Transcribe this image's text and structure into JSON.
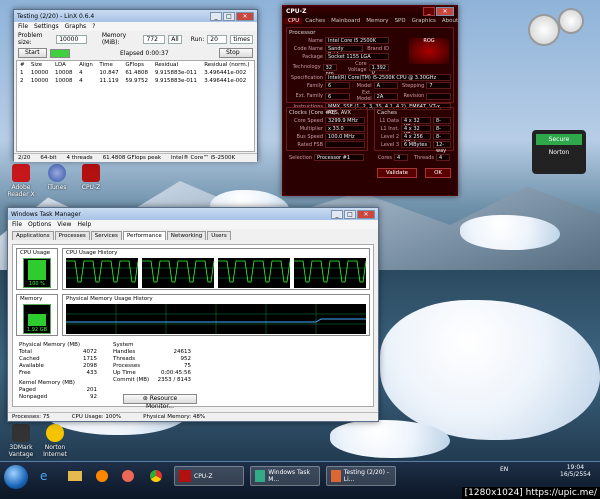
{
  "desktop": {
    "icons": [
      {
        "label": "Adobe Reader X"
      },
      {
        "label": "iTunes"
      },
      {
        "label": "CPU-Z"
      },
      {
        "label": "3DMark Vantage"
      },
      {
        "label": "Norton Internet"
      }
    ],
    "gadget_norton": {
      "status": "Secure",
      "brand": "Norton"
    }
  },
  "linx": {
    "title": "Testing (2/20) - LinX 0.6.4",
    "menu": [
      "File",
      "Settings",
      "Graphs",
      "?"
    ],
    "problem_size_label": "Problem size:",
    "problem_size": "10000",
    "memory_label": "Memory (MiB):",
    "memory": "772",
    "all_label": "All",
    "run_label": "Run:",
    "run": "20",
    "run_unit": "times",
    "start": "Start",
    "elapsed": "Elapsed 0:00:37",
    "stop": "Stop",
    "columns": [
      "#",
      "Size",
      "LDA",
      "Align",
      "Time",
      "GFlops",
      "Residual",
      "Residual (norm.)"
    ],
    "rows": [
      [
        "1",
        "10000",
        "10008",
        "4",
        "10.847",
        "61.4808",
        "9.915883e-011",
        "3.496441e-002"
      ],
      [
        "2",
        "10000",
        "10008",
        "4",
        "11.119",
        "59.9752",
        "9.915883e-011",
        "3.496441e-002"
      ]
    ],
    "status": [
      "2/20",
      "64-bit",
      "4 threads",
      "61.4808 GFlops peak",
      "Intel® Core™ i5-2500K"
    ]
  },
  "cpuz": {
    "title": "CPU-Z",
    "tabs": [
      "CPU",
      "Caches",
      "Mainboard",
      "Memory",
      "SPD",
      "Graphics",
      "About"
    ],
    "processor_header": "Processor",
    "name_label": "Name",
    "name": "Intel Core i5 2500K",
    "codename_label": "Code Name",
    "codename": "Sandy Bridge",
    "brand_id": "Brand ID",
    "package_label": "Package",
    "package": "Socket 1155 LGA",
    "technology_label": "Technology",
    "technology": "32 nm",
    "core_voltage_label": "Core Voltage",
    "core_voltage": "1.392 V",
    "spec_label": "Specification",
    "spec": "Intel(R) Core(TM) i5-2500K CPU @ 3.30GHz",
    "family_label": "Family",
    "family": "6",
    "model_label": "Model",
    "model": "A",
    "stepping_label": "Stepping",
    "stepping": "7",
    "ext_family_label": "Ext. Family",
    "ext_family": "6",
    "ext_model_label": "Ext. Model",
    "ext_model": "2A",
    "revision_label": "Revision",
    "revision": "",
    "instructions_label": "Instructions",
    "instructions": "MMX, SSE (1, 2, 3, 3S, 4.1, 4.2), EM64T, VT-x, AES, AVX",
    "clocks_header": "Clocks (Core #0)",
    "core_speed_label": "Core Speed",
    "core_speed": "3299.9 MHz",
    "multiplier_label": "Multiplier",
    "multiplier": "x 33.0",
    "bus_speed_label": "Bus Speed",
    "bus_speed": "100.0 MHz",
    "rated_fsb_label": "Rated FSB",
    "rated_fsb": "",
    "caches_header": "Caches",
    "l1d_label": "L1 Data",
    "l1d": "4 x 32 KBytes",
    "l1d_way": "8-way",
    "l1i_label": "L1 Inst.",
    "l1i": "4 x 32 KBytes",
    "l1i_way": "8-way",
    "l2_label": "Level 2",
    "l2": "4 x 256 KBytes",
    "l2_way": "8-way",
    "l3_label": "Level 3",
    "l3": "6 MBytes",
    "l3_way": "12-way",
    "selection_label": "Selection",
    "selection": "Processor #1",
    "cores_label": "Cores",
    "cores": "4",
    "threads_label": "Threads",
    "threads": "4",
    "validate": "Validate",
    "ok": "OK"
  },
  "taskmgr": {
    "title": "Windows Task Manager",
    "menu": [
      "File",
      "Options",
      "View",
      "Help"
    ],
    "tabs": [
      "Applications",
      "Processes",
      "Services",
      "Performance",
      "Networking",
      "Users"
    ],
    "cpu_usage_label": "CPU Usage",
    "cpu_usage_value": "100 %",
    "cpu_usage": 1.0,
    "cpu_history_label": "CPU Usage History",
    "memory_label": "Memory",
    "memory_value": "1.92 GB",
    "memory_history_label": "Physical Memory Usage History",
    "phys_mem_header": "Physical Memory (MB)",
    "phys_mem": [
      [
        "Total",
        "4072"
      ],
      [
        "Cached",
        "1715"
      ],
      [
        "Available",
        "2098"
      ],
      [
        "Free",
        "433"
      ]
    ],
    "kernel_header": "Kernel Memory (MB)",
    "kernel": [
      [
        "Paged",
        "201"
      ],
      [
        "Nonpaged",
        "92"
      ]
    ],
    "system_header": "System",
    "system": [
      [
        "Handles",
        "24613"
      ],
      [
        "Threads",
        "952"
      ],
      [
        "Processes",
        "75"
      ],
      [
        "Up Time",
        "0:00:45:56"
      ],
      [
        "Commit (MB)",
        "2353 / 8143"
      ]
    ],
    "resource_monitor": "Resource Monitor...",
    "status": {
      "processes": "Processes: 75",
      "cpu": "CPU Usage: 100%",
      "memory": "Physical Memory: 48%"
    }
  },
  "taskbar": {
    "items": [
      "CPU-Z",
      "Windows Task M...",
      "Testing (2/20) - Li..."
    ],
    "lang": "EN",
    "time": "19:04",
    "date": "16/5/2554"
  },
  "watermark": "[1280x1024] https://upic.me/"
}
